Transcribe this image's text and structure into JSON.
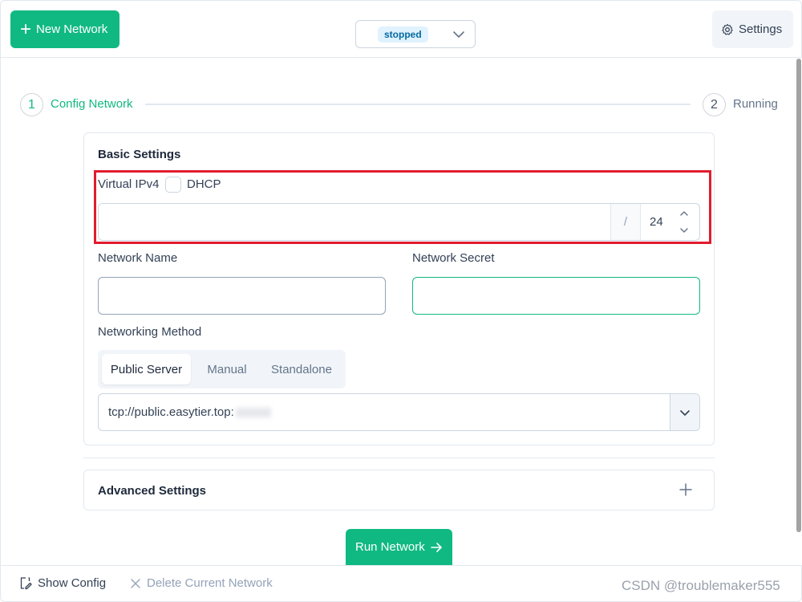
{
  "header": {
    "new_network_label": "New Network",
    "network_status": "stopped",
    "settings_label": "Settings"
  },
  "stepper": {
    "steps": [
      {
        "number": "1",
        "label": "Config Network",
        "state": "active"
      },
      {
        "number": "2",
        "label": "Running",
        "state": "inactive"
      }
    ]
  },
  "basic_settings": {
    "title": "Basic Settings",
    "virtual_ipv4_label": "Virtual IPv4",
    "dhcp_label": "DHCP",
    "dhcp_checked": false,
    "ipv4_value": "",
    "separator": "/",
    "netmask_value": "24",
    "network_name_label": "Network Name",
    "network_name_value": "",
    "network_secret_label": "Network Secret",
    "network_secret_value": "",
    "networking_method_label": "Networking Method",
    "methods": [
      "Public Server",
      "Manual",
      "Standalone"
    ],
    "selected_method": "Public Server",
    "public_server_url": "tcp://public.easytier.top:"
  },
  "advanced_settings": {
    "title": "Advanced Settings"
  },
  "run_button_label": "Run Network",
  "footer": {
    "show_config_label": "Show Config",
    "delete_network_label": "Delete Current Network"
  },
  "watermark": "CSDN @troublemaker555",
  "colors": {
    "primary": "#10b981",
    "highlight_border": "#e11d2e",
    "status_badge_bg": "#e0f2fe",
    "status_badge_text": "#0369a1"
  },
  "icons": {
    "new": "plus-icon",
    "select": "chevron-down-icon",
    "settings": "gear-icon",
    "spin_up": "chevron-up-icon",
    "spin_down": "chevron-down-icon",
    "advanced": "plus-icon",
    "run": "arrow-right-icon",
    "show_config": "edit-document-icon",
    "delete": "close-icon"
  }
}
